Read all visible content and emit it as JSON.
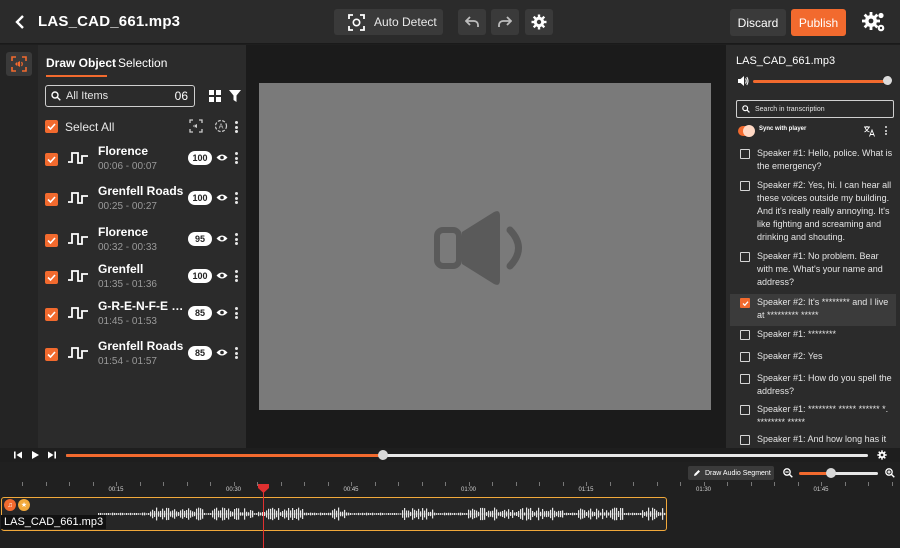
{
  "header": {
    "file_title": "LAS_CAD_661.mp3",
    "auto_detect_label": "Auto Detect",
    "discard_label": "Discard",
    "publish_label": "Publish"
  },
  "object_panel": {
    "tabs": [
      {
        "label": "Draw Object",
        "active": true
      },
      {
        "label": "Selection",
        "active": false
      }
    ],
    "search_placeholder": "All Items",
    "item_count": "06",
    "select_all_label": "Select All",
    "items": [
      {
        "name": "Florence",
        "time": "00:06 - 00:07",
        "score": "100"
      },
      {
        "name": "Grenfell Roads",
        "time": "00:25 - 00:27",
        "score": "100"
      },
      {
        "name": "Florence",
        "time": "00:32 - 00:33",
        "score": "95"
      },
      {
        "name": "Grenfell",
        "time": "01:35 - 01:36",
        "score": "100"
      },
      {
        "name": "G-R-E-N-F-E do..",
        "time": "01:45 - 01:53",
        "score": "85"
      },
      {
        "name": "Grenfell Roads",
        "time": "01:54 - 01:57",
        "score": "85"
      }
    ]
  },
  "transcript": {
    "title": "LAS_CAD_661.mp3",
    "volume": 1.0,
    "search_placeholder": "Search in transcription",
    "sync_label": "Sync with player",
    "sync_enabled": true,
    "utterances": [
      {
        "text": "Speaker #1: Hello, police. What is the emergency?",
        "checked": false
      },
      {
        "text": "Speaker #2: Yes, hi. I can hear all these voices outside my building. And it's really really annoying. It's like fighting and screaming and drinking and shouting.",
        "checked": false
      },
      {
        "text": "Speaker #1: No problem. Bear with me. What's your name and address?",
        "checked": false
      },
      {
        "text": "Speaker #2: It's ******** and I live at ********* *****",
        "checked": true
      },
      {
        "text": "Speaker #1: ********",
        "checked": false
      },
      {
        "text": "Speaker #2: Yes",
        "checked": false
      },
      {
        "text": "Speaker #1: How do you spell the address?",
        "checked": false
      },
      {
        "text": "Speaker #1: ******** ***** ****** *. ******** *****",
        "checked": false
      },
      {
        "text": "Speaker #1: And how long has it",
        "checked": false
      }
    ]
  },
  "player": {
    "progress": 0.395
  },
  "timeline": {
    "draw_segment_label": "Draw Audio Segment",
    "zoom_level": 0.4,
    "ticks": [
      "00:15",
      "00:30",
      "00:45",
      "01:00",
      "01:15",
      "01:30",
      "01:45"
    ],
    "clip_label": "LAS_CAD_661.mp3"
  },
  "colors": {
    "accent": "#f26a2e",
    "clip_border": "#f2a93b",
    "playhead": "#e03030",
    "canvas": "#7a7a7a"
  }
}
